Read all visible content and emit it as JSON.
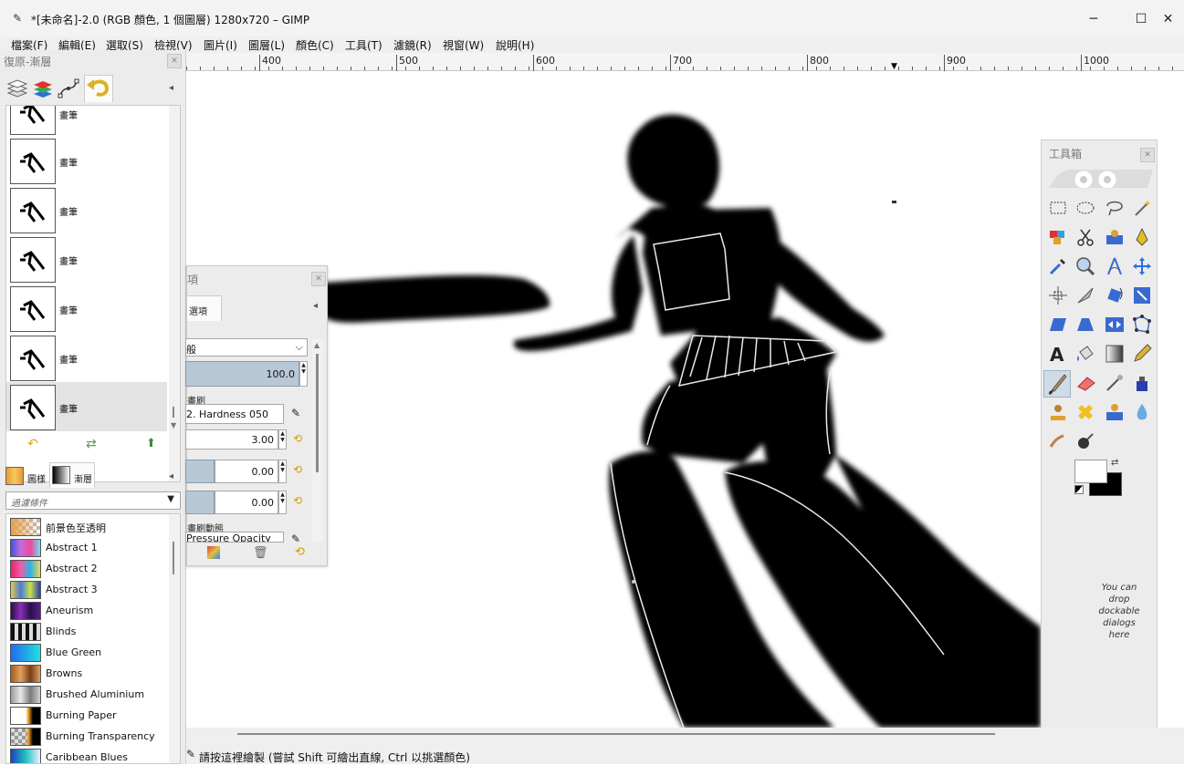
{
  "window": {
    "title": "*[未命名]-2.0 (RGB 顏色, 1 個圖層) 1280x720 – GIMP",
    "minimize": "─",
    "maximize": "☐",
    "close": "✕"
  },
  "menubar": [
    "檔案(F)",
    "編輯(E)",
    "選取(S)",
    "檢視(V)",
    "圖片(I)",
    "圖層(L)",
    "顏色(C)",
    "工具(T)",
    "濾鏡(R)",
    "視窗(W)",
    "說明(H)"
  ],
  "ruler": {
    "labels": [
      "400",
      "500",
      "600",
      "700",
      "800",
      "900",
      "1000"
    ]
  },
  "undo_dock": {
    "title": "復原-漸層",
    "history_label": "畫筆",
    "history_count": 7
  },
  "gradients_dock": {
    "tabs": [
      "圖樣",
      "漸層"
    ],
    "filter_placeholder": "過濾條件",
    "items": [
      {
        "name": "前景色至透明",
        "colors": [
          "#e6a04a",
          "transparent"
        ]
      },
      {
        "name": "Abstract 1",
        "colors": [
          "#3b56e6",
          "#c46cd9",
          "#e94a9b",
          "#6ee0f0"
        ]
      },
      {
        "name": "Abstract 2",
        "colors": [
          "#e6256a",
          "#f05ca8",
          "#27b7e6",
          "#f5d44d"
        ]
      },
      {
        "name": "Abstract 3",
        "colors": [
          "#e4c84a",
          "#4a7bd8",
          "#c8e04a",
          "#2a3db0"
        ]
      },
      {
        "name": "Aneurism",
        "colors": [
          "#2b0f48",
          "#8a2fb8",
          "#2b0f48",
          "#5a1f90"
        ]
      },
      {
        "name": "Blinds",
        "colors": [
          "#111111",
          "#dddddd",
          "#111111",
          "#dddddd"
        ]
      },
      {
        "name": "Blue Green",
        "colors": [
          "#1f6bf0",
          "#22e0e0"
        ]
      },
      {
        "name": "Browns",
        "colors": [
          "#a55a1e",
          "#e0a060",
          "#7a3c14"
        ]
      },
      {
        "name": "Brushed Aluminium",
        "colors": [
          "#9b9b9b",
          "#e8e8e8",
          "#7b7b7b"
        ]
      },
      {
        "name": "Burning Paper",
        "colors": [
          "#ffffff",
          "#f0a020",
          "#000000"
        ]
      },
      {
        "name": "Burning Transparency",
        "colors": [
          "#7a7a7a",
          "#f0a020",
          "#000000"
        ]
      },
      {
        "name": "Caribbean Blues",
        "colors": [
          "#1e3fc0",
          "#20c0c0",
          "#e8f0ff"
        ]
      }
    ]
  },
  "tool_options": {
    "title": "項",
    "tab": "選項",
    "mode": "般",
    "opacity": "100.0",
    "brush_section": "畫刷",
    "brush_name": "2. Hardness 050",
    "size": "3.00",
    "aspect": "0.00",
    "angle": "0.00",
    "dynamics_section": "畫刷動態",
    "dynamics_name": "Pressure Opacity"
  },
  "toolbox": {
    "title": "工具箱",
    "drop_hint": "You can drop dockable dialogs here"
  },
  "statusbar": {
    "message": "請按這裡繪製 (嘗試 Shift 可繪出直線, Ctrl 以挑選顏色)"
  },
  "colors": {
    "foreground": "#ffffff",
    "background": "#000000",
    "canvas": "#ffffff",
    "selection": "#b9c8d6"
  }
}
